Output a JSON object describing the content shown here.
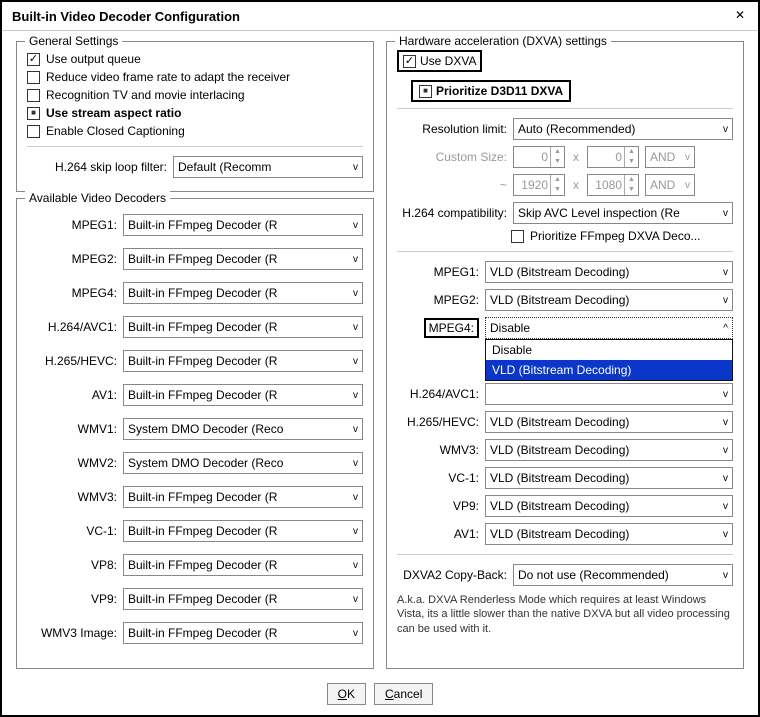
{
  "window": {
    "title": "Built-in Video Decoder Configuration"
  },
  "general": {
    "legend": "General Settings",
    "use_output_queue": "Use output queue",
    "reduce_frame_rate": "Reduce video frame rate to adapt the receiver",
    "recognition_tv": "Recognition TV and movie interlacing",
    "use_stream_aspect": "Use stream aspect ratio",
    "enable_cc": "Enable Closed Captioning",
    "skip_loop_label": "H.264 skip loop filter:",
    "skip_loop_value": "Default (Recomm"
  },
  "decoders": {
    "legend": "Available Video Decoders",
    "rows": [
      {
        "label": "MPEG1:",
        "value": "Built-in FFmpeg Decoder (R"
      },
      {
        "label": "MPEG2:",
        "value": "Built-in FFmpeg Decoder (R"
      },
      {
        "label": "MPEG4:",
        "value": "Built-in FFmpeg Decoder (R"
      },
      {
        "label": "H.264/AVC1:",
        "value": "Built-in FFmpeg Decoder (R"
      },
      {
        "label": "H.265/HEVC:",
        "value": "Built-in FFmpeg Decoder (R"
      },
      {
        "label": "AV1:",
        "value": "Built-in FFmpeg Decoder (R"
      },
      {
        "label": "WMV1:",
        "value": "System DMO Decoder (Reco"
      },
      {
        "label": "WMV2:",
        "value": "System DMO Decoder (Reco"
      },
      {
        "label": "WMV3:",
        "value": "Built-in FFmpeg Decoder (R"
      },
      {
        "label": "VC-1:",
        "value": "Built-in FFmpeg Decoder (R"
      },
      {
        "label": "VP8:",
        "value": "Built-in FFmpeg Decoder (R"
      },
      {
        "label": "VP9:",
        "value": "Built-in FFmpeg Decoder (R"
      },
      {
        "label": "WMV3 Image:",
        "value": "Built-in FFmpeg Decoder (R"
      }
    ]
  },
  "dxva": {
    "legend": "Hardware acceleration (DXVA) settings",
    "use_dxva": "Use DXVA",
    "prioritize_d3d11": "Prioritize D3D11 DXVA",
    "res_limit_label": "Resolution limit:",
    "res_limit_value": "Auto (Recommended)",
    "custom_size_label": "Custom Size:",
    "custom_w": "0",
    "custom_h": "0",
    "custom_op": "AND",
    "tilde": "~",
    "max_w": "1920",
    "max_h": "1080",
    "max_op": "AND",
    "compat_label": "H.264 compatibility:",
    "compat_value": "Skip AVC Level inspection (Re",
    "prioritize_ffmpeg": "Prioritize FFmpeg DXVA Deco...",
    "codecs": [
      {
        "label": "MPEG1:",
        "value": "VLD (Bitstream Decoding)"
      },
      {
        "label": "MPEG2:",
        "value": "VLD (Bitstream Decoding)"
      }
    ],
    "mpeg4_label": "MPEG4:",
    "mpeg4_value": "Disable",
    "mpeg4_options": {
      "opt0": "Disable",
      "opt1": "VLD (Bitstream Decoding)"
    },
    "codecs_after": [
      {
        "label": "H.264/AVC1:",
        "value": ""
      },
      {
        "label": "H.265/HEVC:",
        "value": "VLD (Bitstream Decoding)"
      },
      {
        "label": "WMV3:",
        "value": "VLD (Bitstream Decoding)"
      },
      {
        "label": "VC-1:",
        "value": "VLD (Bitstream Decoding)"
      },
      {
        "label": "VP9:",
        "value": "VLD (Bitstream Decoding)"
      },
      {
        "label": "AV1:",
        "value": "VLD (Bitstream Decoding)"
      }
    ],
    "copyback_label": "DXVA2 Copy-Back:",
    "copyback_value": "Do not use (Recommended)",
    "note": "A.k.a. DXVA Renderless Mode which requires at least Windows Vista, its a little slower than the native DXVA but all video processing can be used with it."
  },
  "footer": {
    "ok_u": "O",
    "ok_rest": "K",
    "cancel_u": "C",
    "cancel_rest": "ancel"
  }
}
